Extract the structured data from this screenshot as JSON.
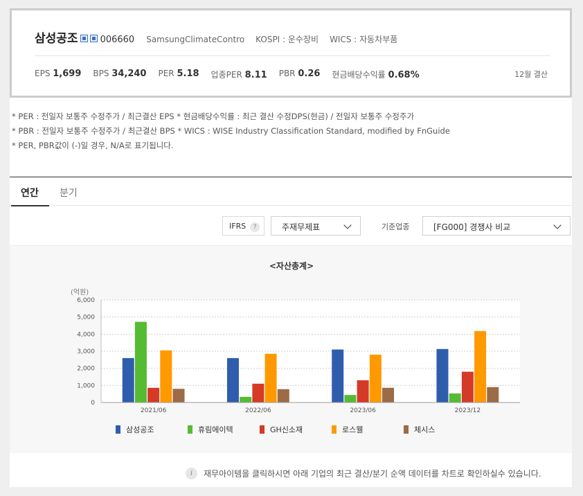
{
  "company": {
    "name": "삼성공조",
    "code": "006660",
    "eng_name": "SamsungClimateContro",
    "kospi": "KOSPI : 운수장비",
    "wics": "WICS : 자동차부품"
  },
  "metrics": [
    {
      "label": "EPS",
      "value": "1,699"
    },
    {
      "label": "BPS",
      "value": "34,240"
    },
    {
      "label": "PER",
      "value": "5.18"
    },
    {
      "label": "업종PER",
      "value": "8.11"
    },
    {
      "label": "PBR",
      "value": "0.26"
    },
    {
      "label": "현금배당수익률",
      "value": "0.68%"
    }
  ],
  "settlement": "12월 결산",
  "notes": [
    "* PER : 전일자 보통주 수정주가 / 최근결산 EPS * 현금배당수익률 : 최근 결산 수정DPS(현금) / 전일자 보통주 수정주가",
    "* PBR : 전일자 보통주 수정주가 / 최근결산 BPS * WICS : WISE Industry Classification Standard, modified by FnGuide",
    "* PER, PBR값이 (-)일 경우, N/A로 표기됩니다."
  ],
  "tabs": {
    "annual": "연간",
    "quarter": "분기"
  },
  "filters": {
    "ifrs_label": "IFRS",
    "help_symbol": "?",
    "statement_select": "주재무제표",
    "industry_label": "기준업종",
    "industry_select": "[FG000] 경쟁사 비교"
  },
  "chart_title": "<자산총계>",
  "chart_data": {
    "type": "bar",
    "title": "<자산총계>",
    "ylabel": "(억원)",
    "ylim": [
      0,
      6000
    ],
    "yticks": [
      "0",
      "1,000",
      "2,000",
      "3,000",
      "4,000",
      "5,000",
      "6,000"
    ],
    "categories": [
      "2021/06",
      "2022/06",
      "2023/06",
      "2023/12"
    ],
    "series": [
      {
        "name": "삼성공조",
        "color": "#2f5dae",
        "values": [
          2600,
          2600,
          3100,
          3130
        ]
      },
      {
        "name": "휴림에이텍",
        "color": "#55bb33",
        "values": [
          4720,
          330,
          440,
          530
        ]
      },
      {
        "name": "GH신소재",
        "color": "#d43a26",
        "values": [
          860,
          1100,
          1300,
          1800
        ]
      },
      {
        "name": "로스웰",
        "color": "#ff9900",
        "values": [
          3050,
          2850,
          2800,
          4180
        ]
      },
      {
        "name": "체시스",
        "color": "#9c6b47",
        "values": [
          800,
          780,
          860,
          900
        ]
      }
    ],
    "grid": true,
    "legend": "bottom"
  },
  "info": {
    "icon": "i",
    "text": "재무아이템을 클릭하시면 아래 기업의 최근 결산/분기 순액 데이터를 차트로 확인하실수 있습니다."
  }
}
